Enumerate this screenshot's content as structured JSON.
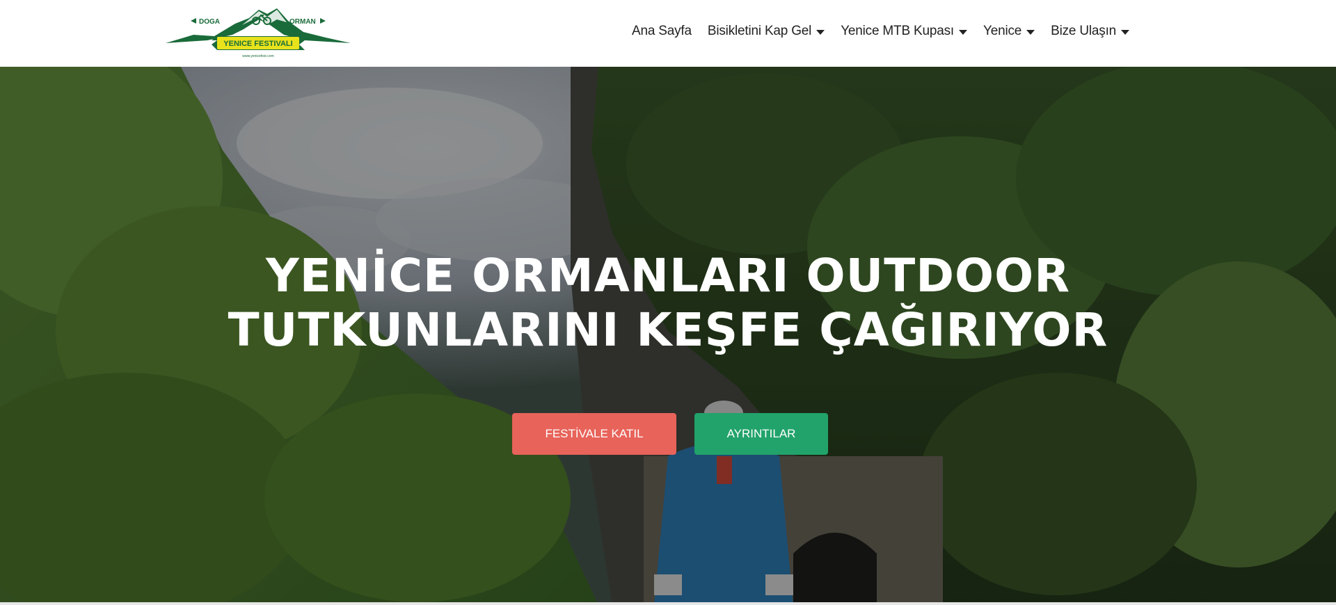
{
  "logo": {
    "left_word": "DOGA",
    "right_word": "ORMAN",
    "banner": "YENICE FESTIVALI",
    "small_url": "www.yenicefest.com"
  },
  "nav": {
    "items": [
      {
        "label": "Ana Sayfa",
        "has_dropdown": false
      },
      {
        "label": "Bisikletini Kap Gel",
        "has_dropdown": true
      },
      {
        "label": "Yenice MTB Kupası",
        "has_dropdown": true
      },
      {
        "label": "Yenice",
        "has_dropdown": true
      },
      {
        "label": "Bize Ulaşın",
        "has_dropdown": true
      }
    ]
  },
  "hero": {
    "title_line1": "YENİCE ORMANLARI OUTDOOR",
    "title_line2": "TUTKUNLARINI KEŞFE ÇAĞIRIYOR",
    "primary_button": "FESTİVALE KATIL",
    "secondary_button": "AYRINTILAR"
  },
  "colors": {
    "primary_button": "#e8635a",
    "secondary_button": "#22a36b",
    "logo_green": "#1a6b3a",
    "logo_yellow": "#e8e21c"
  },
  "icons": {
    "dropdown": "caret-down-icon",
    "logo_mark": "mountain-bike-icon"
  }
}
